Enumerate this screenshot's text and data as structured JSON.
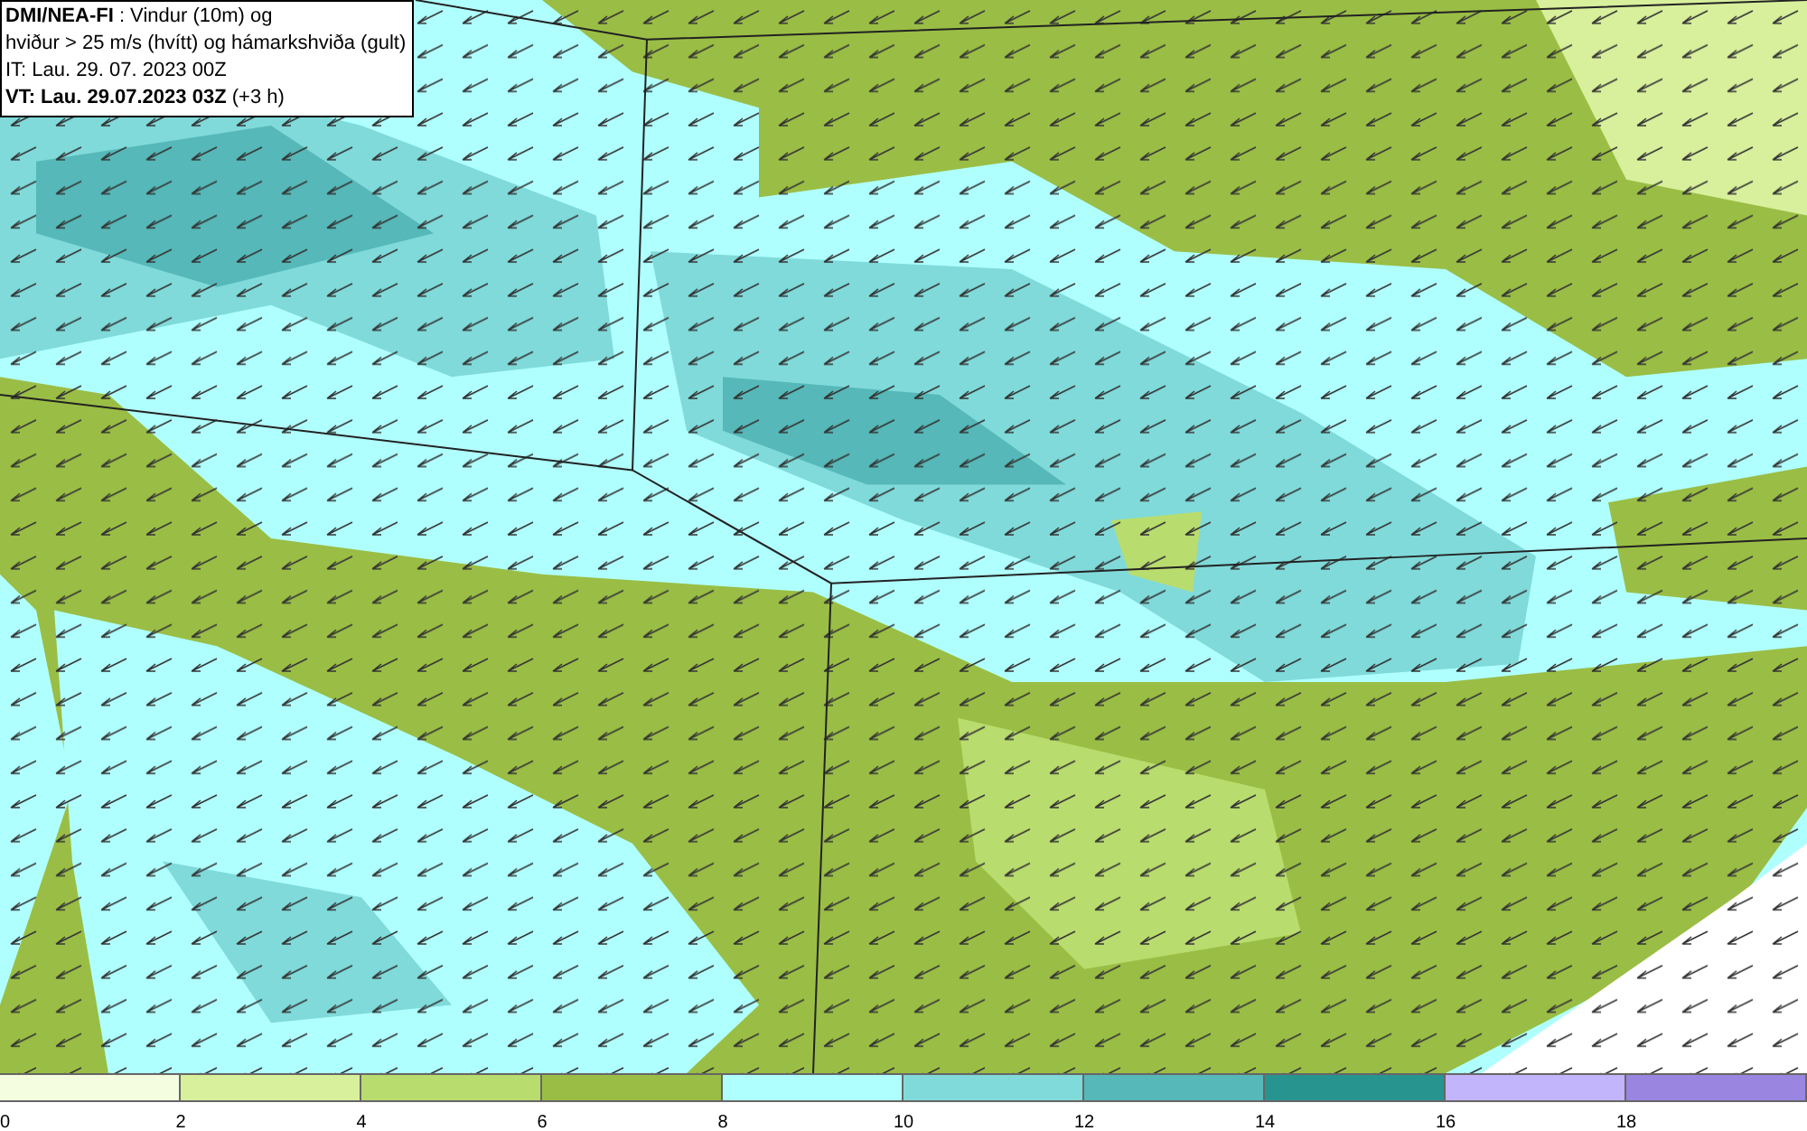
{
  "legend": {
    "lines": [
      "**DMI/NEA-FI** : Vindur (10m) og",
      "hviður > 25 m/s (hvítt) og hámarkshviða (gult)",
      "IT: Lau. 29. 07. 2023 00Z",
      "**VT: Lau. 29.07.2023 03Z** (+3 h)"
    ]
  },
  "colorbar": {
    "swatches": [
      {
        "color": "#f5fde0"
      },
      {
        "color": "#d8ef9c"
      },
      {
        "color": "#b9dc6e"
      },
      {
        "color": "#9abe45"
      },
      {
        "color": "#b0ffff"
      },
      {
        "color": "#80dada"
      },
      {
        "color": "#56b8b8"
      },
      {
        "color": "#279490"
      },
      {
        "color": "#c3b5fb"
      },
      {
        "color": "#9a85e0"
      }
    ],
    "ticks": [
      "0",
      "2",
      "4",
      "6",
      "8",
      "10",
      "12",
      "14",
      "16",
      "18"
    ]
  }
}
